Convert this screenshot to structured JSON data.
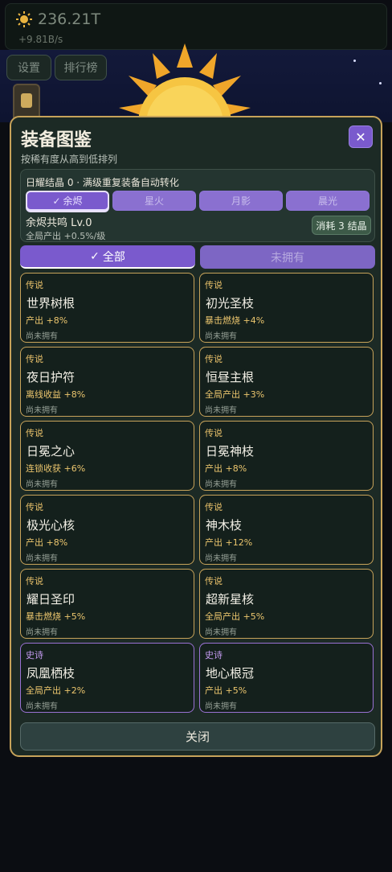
{
  "header": {
    "resource_value": "236.21T",
    "resource_rate": "+9.81B/s",
    "settings_label": "设置",
    "ranking_label": "排行榜"
  },
  "modal": {
    "title": "装备图鉴",
    "close_icon_label": "✕",
    "subtitle": "按稀有度从高到低排列",
    "crystal_info": "日耀结晶 0 · 满级重复装备自动转化",
    "element_tabs": [
      {
        "label": "余烬",
        "active": true
      },
      {
        "label": "星火",
        "active": false
      },
      {
        "label": "月影",
        "active": false
      },
      {
        "label": "晨光",
        "active": false
      }
    ],
    "resonance_label": "余烬共鸣  Lv.0",
    "resonance_bonus": "全局产出 +0.5%/级",
    "consume_label": "消耗 3 结晶",
    "filters": {
      "all": "全部",
      "unowned": "未拥有"
    },
    "cards": [
      {
        "rarity": "传说",
        "name": "世界树根",
        "effect": "产出 +8%",
        "status": "尚未拥有",
        "tier": "legend"
      },
      {
        "rarity": "传说",
        "name": "初光圣枝",
        "effect": "暴击燃烧 +4%",
        "status": "尚未拥有",
        "tier": "legend"
      },
      {
        "rarity": "传说",
        "name": "夜日护符",
        "effect": "离线收益 +8%",
        "status": "尚未拥有",
        "tier": "legend"
      },
      {
        "rarity": "传说",
        "name": "恒昼主根",
        "effect": "全局产出 +3%",
        "status": "尚未拥有",
        "tier": "legend"
      },
      {
        "rarity": "传说",
        "name": "日冕之心",
        "effect": "连锁收获 +6%",
        "status": "尚未拥有",
        "tier": "legend"
      },
      {
        "rarity": "传说",
        "name": "日冕神枝",
        "effect": "产出 +8%",
        "status": "尚未拥有",
        "tier": "legend"
      },
      {
        "rarity": "传说",
        "name": "极光心核",
        "effect": "产出 +8%",
        "status": "尚未拥有",
        "tier": "legend"
      },
      {
        "rarity": "传说",
        "name": "神木枝",
        "effect": "产出 +12%",
        "status": "尚未拥有",
        "tier": "legend"
      },
      {
        "rarity": "传说",
        "name": "耀日圣印",
        "effect": "暴击燃烧 +5%",
        "status": "尚未拥有",
        "tier": "legend"
      },
      {
        "rarity": "传说",
        "name": "超新星核",
        "effect": "全局产出 +5%",
        "status": "尚未拥有",
        "tier": "legend"
      },
      {
        "rarity": "史诗",
        "name": "凤凰栖枝",
        "effect": "全局产出 +2%",
        "status": "尚未拥有",
        "tier": "epic"
      },
      {
        "rarity": "史诗",
        "name": "地心根冠",
        "effect": "产出 +5%",
        "status": "尚未拥有",
        "tier": "epic"
      }
    ],
    "close_button": "关闭"
  }
}
